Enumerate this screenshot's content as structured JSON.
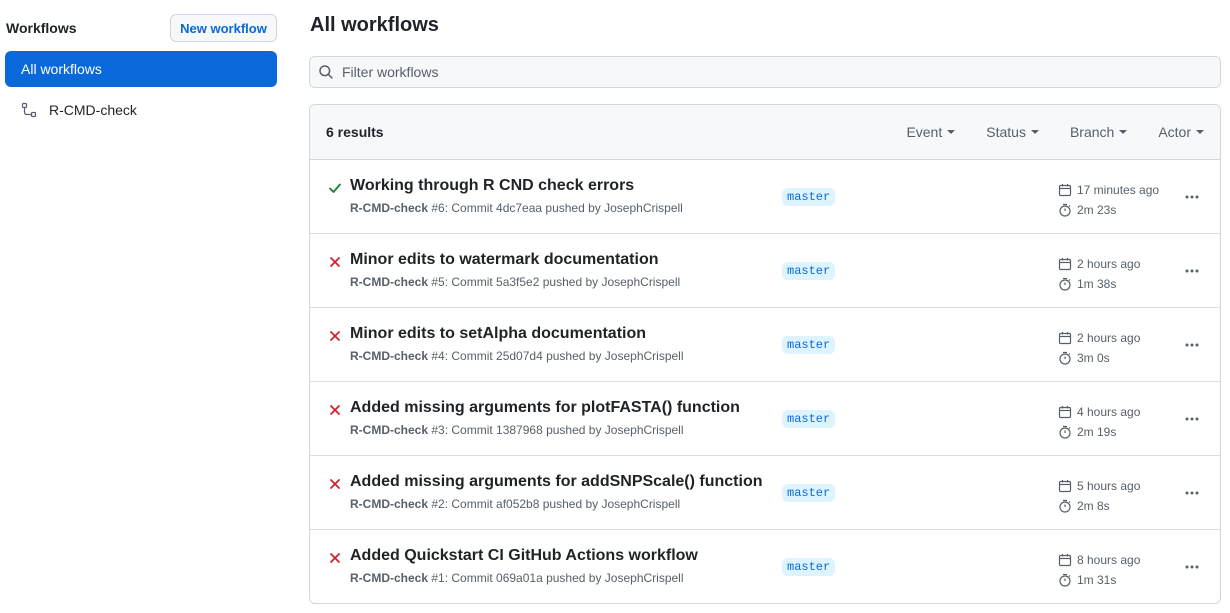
{
  "sidebar": {
    "title": "Workflows",
    "new_button": "New workflow",
    "items": [
      {
        "label": "All workflows",
        "active": true
      },
      {
        "label": "R-CMD-check",
        "active": false
      }
    ]
  },
  "main": {
    "title": "All workflows",
    "filter_placeholder": "Filter workflows",
    "results_count": "6 results",
    "filters": [
      "Event",
      "Status",
      "Branch",
      "Actor"
    ],
    "runs": [
      {
        "status": "success",
        "title": "Working through R CND check errors",
        "workflow": "R-CMD-check",
        "meta": " #6: Commit 4dc7eaa pushed by JosephCrispell",
        "branch": "master",
        "when": "17 minutes ago",
        "duration": "2m 23s"
      },
      {
        "status": "failure",
        "title": "Minor edits to watermark documentation",
        "workflow": "R-CMD-check",
        "meta": " #5: Commit 5a3f5e2 pushed by JosephCrispell",
        "branch": "master",
        "when": "2 hours ago",
        "duration": "1m 38s"
      },
      {
        "status": "failure",
        "title": "Minor edits to setAlpha documentation",
        "workflow": "R-CMD-check",
        "meta": " #4: Commit 25d07d4 pushed by JosephCrispell",
        "branch": "master",
        "when": "2 hours ago",
        "duration": "3m 0s"
      },
      {
        "status": "failure",
        "title": "Added missing arguments for plotFASTA() function",
        "workflow": "R-CMD-check",
        "meta": " #3: Commit 1387968 pushed by JosephCrispell",
        "branch": "master",
        "when": "4 hours ago",
        "duration": "2m 19s"
      },
      {
        "status": "failure",
        "title": "Added missing arguments for addSNPScale() function",
        "workflow": "R-CMD-check",
        "meta": " #2: Commit af052b8 pushed by JosephCrispell",
        "branch": "master",
        "when": "5 hours ago",
        "duration": "2m 8s"
      },
      {
        "status": "failure",
        "title": "Added Quickstart CI GitHub Actions workflow",
        "workflow": "R-CMD-check",
        "meta": " #1: Commit 069a01a pushed by JosephCrispell",
        "branch": "master",
        "when": "8 hours ago",
        "duration": "1m 31s"
      }
    ]
  },
  "colors": {
    "accent": "#0969da",
    "success": "#1a7f37",
    "failure": "#cf222e",
    "branch_bg": "#ddf4ff"
  },
  "icons": {
    "success": "check-icon",
    "failure": "x-icon",
    "workflow": "workflow-icon",
    "search": "search-icon",
    "calendar": "calendar-icon",
    "stopwatch": "stopwatch-icon",
    "more": "kebab-horizontal-icon"
  }
}
